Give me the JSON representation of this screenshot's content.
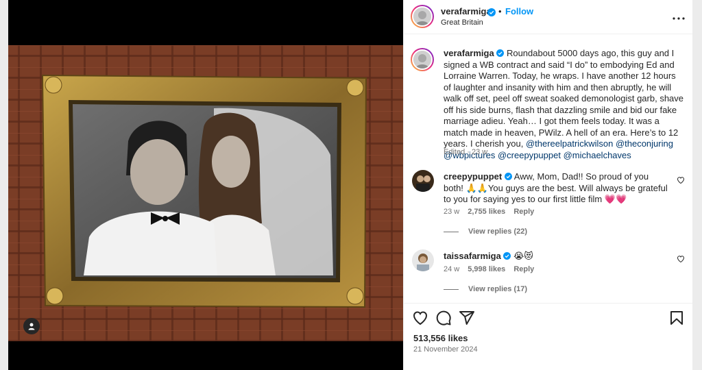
{
  "post": {
    "username": "verafarmiga",
    "location": "Great Britain",
    "follow_label": "Follow",
    "dot": "•"
  },
  "caption": {
    "username": "verafarmiga",
    "text": " Roundabout 5000 days ago, this guy and I signed a WB contract and said “I do” to embodying Ed and Lorraine Warren. Today, he wraps. I have another 12 hours of laughter and insanity with him and then abruptly, he will walk off set, peel off sweat soaked demonologist garb, shave off his side burns, flash that dazzling smile and bid our fake marriage adieu. Yeah… I got them feels today. It was a match made in heaven, PWilz. A hell of an era. Here’s to 12 years. I cherish you, ",
    "mentions": [
      "@thereelpatrickwilson",
      "@theconjuring",
      "@wbpictures",
      "@creepypuppet",
      "@michaelchaves"
    ],
    "meta": "Edited · 23 w"
  },
  "comments": [
    {
      "username": "creepypuppet",
      "text": " Aww, Mom, Dad!! So proud of you both! 🙏🙏You guys are the best. Will always be grateful to you for saying yes to our first little film 💗💗",
      "age": "23 w",
      "likes": "2,755 likes",
      "reply_label": "Reply",
      "view_replies": "View replies (22)"
    },
    {
      "username": "taissafarmiga",
      "text": " 😭😻",
      "age": "24 w",
      "likes": "5,998 likes",
      "reply_label": "Reply",
      "view_replies": "View replies (17)"
    }
  ],
  "footer": {
    "likes": "513,556 likes",
    "date": "21 November 2024"
  },
  "icons": {
    "verified": "verified-badge-icon",
    "more": "more-options-icon",
    "like": "heart-icon",
    "comment": "comment-bubble-icon",
    "share": "paper-plane-icon",
    "save": "bookmark-icon",
    "user_tag": "user-tag-icon"
  },
  "colors": {
    "accent": "#0095f6",
    "verified": "#0095f6",
    "mention": "#00376b",
    "muted": "#737373"
  }
}
